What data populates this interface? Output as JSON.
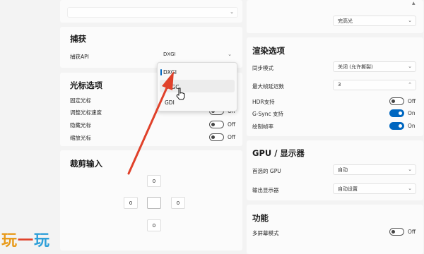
{
  "left": {
    "capture": {
      "title": "捕获",
      "api_label": "捕获API",
      "api_value": "DXGI",
      "menu_options": [
        "DXGI",
        "WGC",
        "GDI"
      ]
    },
    "cursor": {
      "title": "光标选项",
      "rows": [
        {
          "label": "固定光标",
          "state": "Off",
          "on": false
        },
        {
          "label": "调整光标速度",
          "state": "Off",
          "on": false
        },
        {
          "label": "隐藏光标",
          "state": "Off",
          "on": false
        },
        {
          "label": "缩放光标",
          "state": "Off",
          "on": false
        }
      ]
    },
    "crop": {
      "title": "裁剪输入",
      "top": "0",
      "left": "0",
      "right": "0",
      "bottom": "0"
    }
  },
  "right": {
    "top_dropdown_value": "完高光",
    "render": {
      "title": "渲染选项",
      "sync_label": "同步模式",
      "sync_value": "关闭 (允许撕裂)",
      "frames_label": "最大帧延迟数",
      "frames_value": "3",
      "rows": [
        {
          "label": "HDR支持",
          "state": "Off",
          "on": false
        },
        {
          "label": "G-Sync 支持",
          "state": "On",
          "on": true
        },
        {
          "label": "绘制帧率",
          "state": "On",
          "on": true
        }
      ]
    },
    "gpu": {
      "title": "GPU / 显示器",
      "pref_label": "首选的 GPU",
      "pref_value": "自动",
      "output_label": "输出显示器",
      "output_value": "自动设置"
    },
    "features": {
      "title": "功能",
      "multi_label": "多屏幕模式",
      "multi_state": "Off"
    }
  },
  "watermark": {
    "a": "玩",
    "b": "一",
    "c": "玩"
  },
  "colors": {
    "accent": "#0067c0",
    "arrow": "#e0412a"
  }
}
